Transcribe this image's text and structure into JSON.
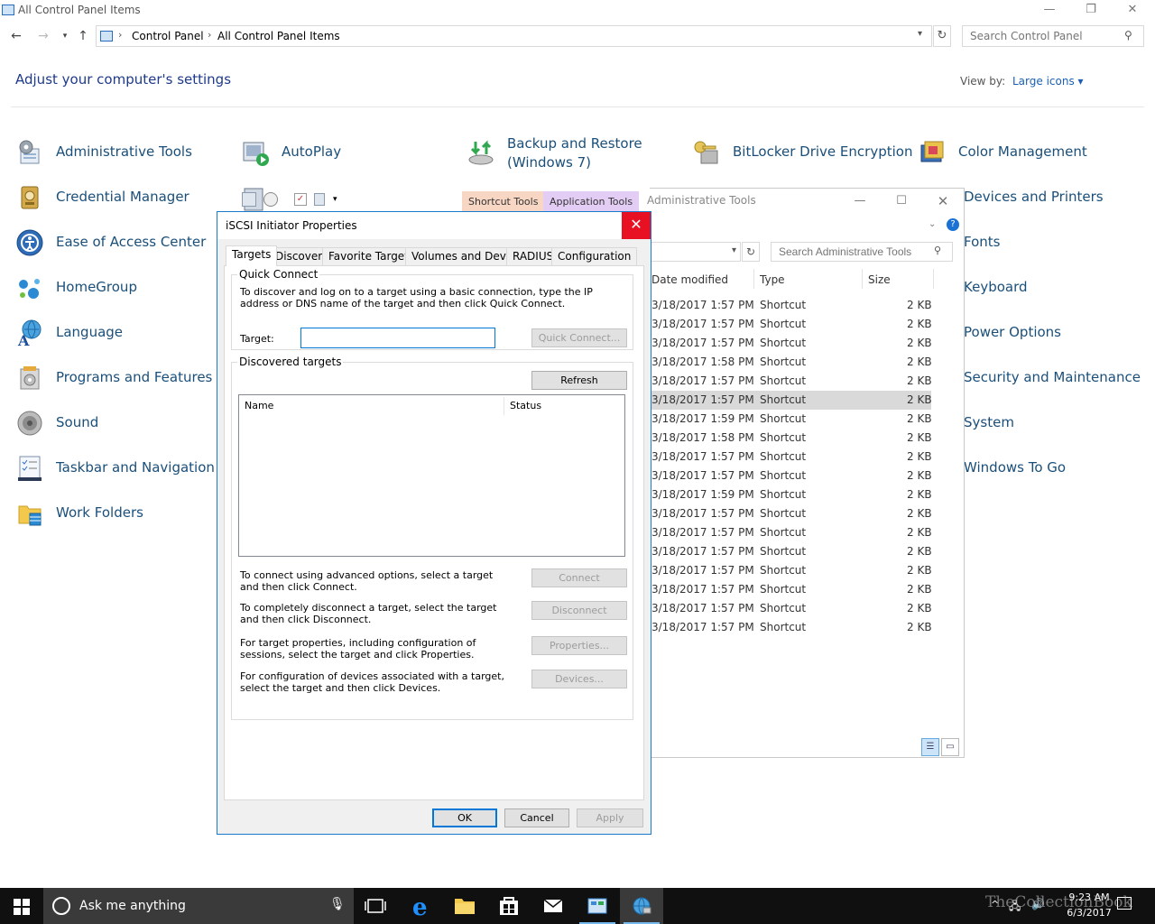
{
  "cp": {
    "title": "All Control Panel Items",
    "breadcrumb": [
      "Control Panel",
      "All Control Panel Items"
    ],
    "search_placeholder": "Search Control Panel",
    "heading": "Adjust your computer's settings",
    "view_by_label": "View by:",
    "view_by_value": "Large icons ▾",
    "items_col1": [
      "Administrative Tools",
      "Credential Manager",
      "Ease of Access Center",
      "HomeGroup",
      "Language",
      "Programs and Features",
      "Sound",
      "Taskbar and Navigation",
      "Work Folders"
    ],
    "items_col2": [
      "AutoPlay"
    ],
    "item_backup_line1": "Backup and Restore",
    "item_backup_line2": "(Windows 7)",
    "item_bitlocker": "BitLocker Drive Encryption",
    "items_col5": [
      "Color Management",
      "Devices and Printers",
      "Fonts",
      "Keyboard",
      "Power Options",
      "Security and Maintenance",
      "System",
      "Windows To Go"
    ]
  },
  "at": {
    "title": "Administrative Tools",
    "tab_shortcut": "Shortcut Tools",
    "tab_application": "Application Tools",
    "search_placeholder": "Search Administrative Tools",
    "col_date": "Date modified",
    "col_type": "Type",
    "col_size": "Size",
    "rows": [
      {
        "date": "3/18/2017 1:57 PM",
        "type": "Shortcut",
        "size": "2 KB"
      },
      {
        "date": "3/18/2017 1:57 PM",
        "type": "Shortcut",
        "size": "2 KB"
      },
      {
        "date": "3/18/2017 1:57 PM",
        "type": "Shortcut",
        "size": "2 KB"
      },
      {
        "date": "3/18/2017 1:58 PM",
        "type": "Shortcut",
        "size": "2 KB"
      },
      {
        "date": "3/18/2017 1:57 PM",
        "type": "Shortcut",
        "size": "2 KB"
      },
      {
        "date": "3/18/2017 1:57 PM",
        "type": "Shortcut",
        "size": "2 KB"
      },
      {
        "date": "3/18/2017 1:59 PM",
        "type": "Shortcut",
        "size": "2 KB"
      },
      {
        "date": "3/18/2017 1:58 PM",
        "type": "Shortcut",
        "size": "2 KB"
      },
      {
        "date": "3/18/2017 1:57 PM",
        "type": "Shortcut",
        "size": "2 KB"
      },
      {
        "date": "3/18/2017 1:57 PM",
        "type": "Shortcut",
        "size": "2 KB"
      },
      {
        "date": "3/18/2017 1:59 PM",
        "type": "Shortcut",
        "size": "2 KB"
      },
      {
        "date": "3/18/2017 1:57 PM",
        "type": "Shortcut",
        "size": "2 KB"
      },
      {
        "date": "3/18/2017 1:57 PM",
        "type": "Shortcut",
        "size": "2 KB"
      },
      {
        "date": "3/18/2017 1:57 PM",
        "type": "Shortcut",
        "size": "2 KB"
      },
      {
        "date": "3/18/2017 1:57 PM",
        "type": "Shortcut",
        "size": "2 KB"
      },
      {
        "date": "3/18/2017 1:57 PM",
        "type": "Shortcut",
        "size": "2 KB"
      },
      {
        "date": "3/18/2017 1:57 PM",
        "type": "Shortcut",
        "size": "2 KB"
      },
      {
        "date": "3/18/2017 1:57 PM",
        "type": "Shortcut",
        "size": "2 KB"
      }
    ]
  },
  "dlg": {
    "title": "iSCSI Initiator Properties",
    "close": "✕",
    "tabs": [
      "Targets",
      "Discovery",
      "Favorite Targets",
      "Volumes and Devices",
      "RADIUS",
      "Configuration"
    ],
    "quick_connect_title": "Quick Connect",
    "quick_connect_desc": "To discover and log on to a target using a basic connection, type the IP address or DNS name of the target and then click Quick Connect.",
    "target_label": "Target:",
    "target_value": "",
    "quick_connect_btn": "Quick Connect...",
    "discovered_title": "Discovered targets",
    "refresh_btn": "Refresh",
    "col_name": "Name",
    "col_status": "Status",
    "connect_desc": "To connect using advanced options, select a target and then click Connect.",
    "connect_btn": "Connect",
    "disconnect_desc": "To completely disconnect a target, select the target and then click Disconnect.",
    "disconnect_btn": "Disconnect",
    "properties_desc": "For target properties, including configuration of sessions, select the target and click Properties.",
    "properties_btn": "Properties...",
    "devices_desc": "For configuration of devices associated with a target, select the target and then click Devices.",
    "devices_btn": "Devices...",
    "ok_btn": "OK",
    "cancel_btn": "Cancel",
    "apply_btn": "Apply"
  },
  "taskbar": {
    "search_placeholder": "Ask me anything",
    "time": "9:23 AM",
    "date": "6/3/2017",
    "watermark": "TheCollectionBook"
  },
  "colors": {
    "accent": "#0078d7",
    "close_red": "#e81123",
    "taskbar": "#101010",
    "link_blue": "#1a4f7a"
  }
}
